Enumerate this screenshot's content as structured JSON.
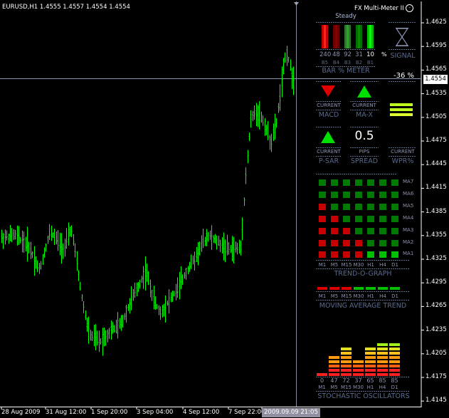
{
  "chart": {
    "symbol_info": "EURUSD,H1  1.4555 1.4557 1.4554 1.4554",
    "current_price": "1.4554",
    "price_axis": [
      "1.4625",
      "1.4595",
      "1.4565",
      "1.4535",
      "1.4505",
      "1.4475",
      "1.4445",
      "1.4415",
      "1.4385",
      "1.4355",
      "1.4325",
      "1.4295",
      "1.4265",
      "1.4235",
      "1.4205",
      "1.4175",
      "1.4145"
    ],
    "time_axis": [
      "28 Aug 2009",
      "31 Aug 12:00",
      "1 Sep 20:00",
      "3 Sep 04:00",
      "4 Sep 12:00",
      "7 Sep 22:00",
      "2009.09.09 21:05"
    ],
    "colors": {
      "bars": "#00ff00",
      "background": "#000000",
      "axis_text": "#ffffff"
    }
  },
  "meter": {
    "title": "FX Multi-Meter II",
    "title_icon": "smiley-icon",
    "state": "Steady",
    "bar_values": [
      "240",
      "48",
      "92",
      "31",
      "10"
    ],
    "bar_percent_sign": "%",
    "bar_labels": [
      "B5",
      "B4",
      "B3",
      "B2",
      "B1"
    ],
    "bar_meter_title": "BAR % METER",
    "signal_label": "SIGNAL",
    "signal_icon": "hourglass-icon",
    "wpr_value": "-36 %",
    "macd": {
      "sub": "CURRENT",
      "label": "MACD",
      "arrow": "down"
    },
    "max": {
      "sub": "CURRENT",
      "label": "MA-X",
      "arrow": "up"
    },
    "psar": {
      "sub": "CURRENT",
      "label": "P-SAR",
      "arrow": "up"
    },
    "spread": {
      "value": "0.5",
      "sub": "PIPS",
      "label": "SPREAD"
    },
    "wpr": {
      "sub": "CURRENT",
      "label": "WPR%"
    },
    "trend_rows": [
      "MA7",
      "MA6",
      "MA5",
      "MA4",
      "MA3",
      "MA2",
      "MA1"
    ],
    "trend_cols": [
      "M1",
      "M5",
      "M15",
      "M30",
      "H1",
      "H4",
      "D1"
    ],
    "trend_grid": [
      [
        "g",
        "g",
        "g",
        "g",
        "g",
        "g",
        "g"
      ],
      [
        "g",
        "g",
        "g",
        "g",
        "g",
        "g",
        "g"
      ],
      [
        "r",
        "g",
        "g",
        "g",
        "g",
        "g",
        "g"
      ],
      [
        "r",
        "r",
        "g",
        "g",
        "g",
        "g",
        "g"
      ],
      [
        "r",
        "r",
        "r",
        "g",
        "g",
        "g",
        "g"
      ],
      [
        "r",
        "r",
        "r",
        "r",
        "g",
        "g",
        "g"
      ],
      [
        "r",
        "r",
        "r",
        "r",
        "b",
        "b",
        "b"
      ]
    ],
    "trend_title": "TREND-O-GRAPH",
    "ma_trend": [
      "r",
      "r",
      "r",
      "g",
      "g",
      "g",
      "g"
    ],
    "ma_trend_title": "MOVING AVERAGE TREND",
    "stoch_values": [
      "0",
      "47",
      "72",
      "37",
      "65",
      "85",
      "85"
    ],
    "stoch_cols": [
      "M1",
      "M5",
      "M15",
      "M30",
      "H1",
      "H4",
      "D1"
    ],
    "stoch_title": "STOCHASTIC OSCILLATORS",
    "colors": {
      "red": "#c80000",
      "green": "#00c000",
      "dim": "#5a6a8a",
      "white": "#ffffff"
    }
  }
}
